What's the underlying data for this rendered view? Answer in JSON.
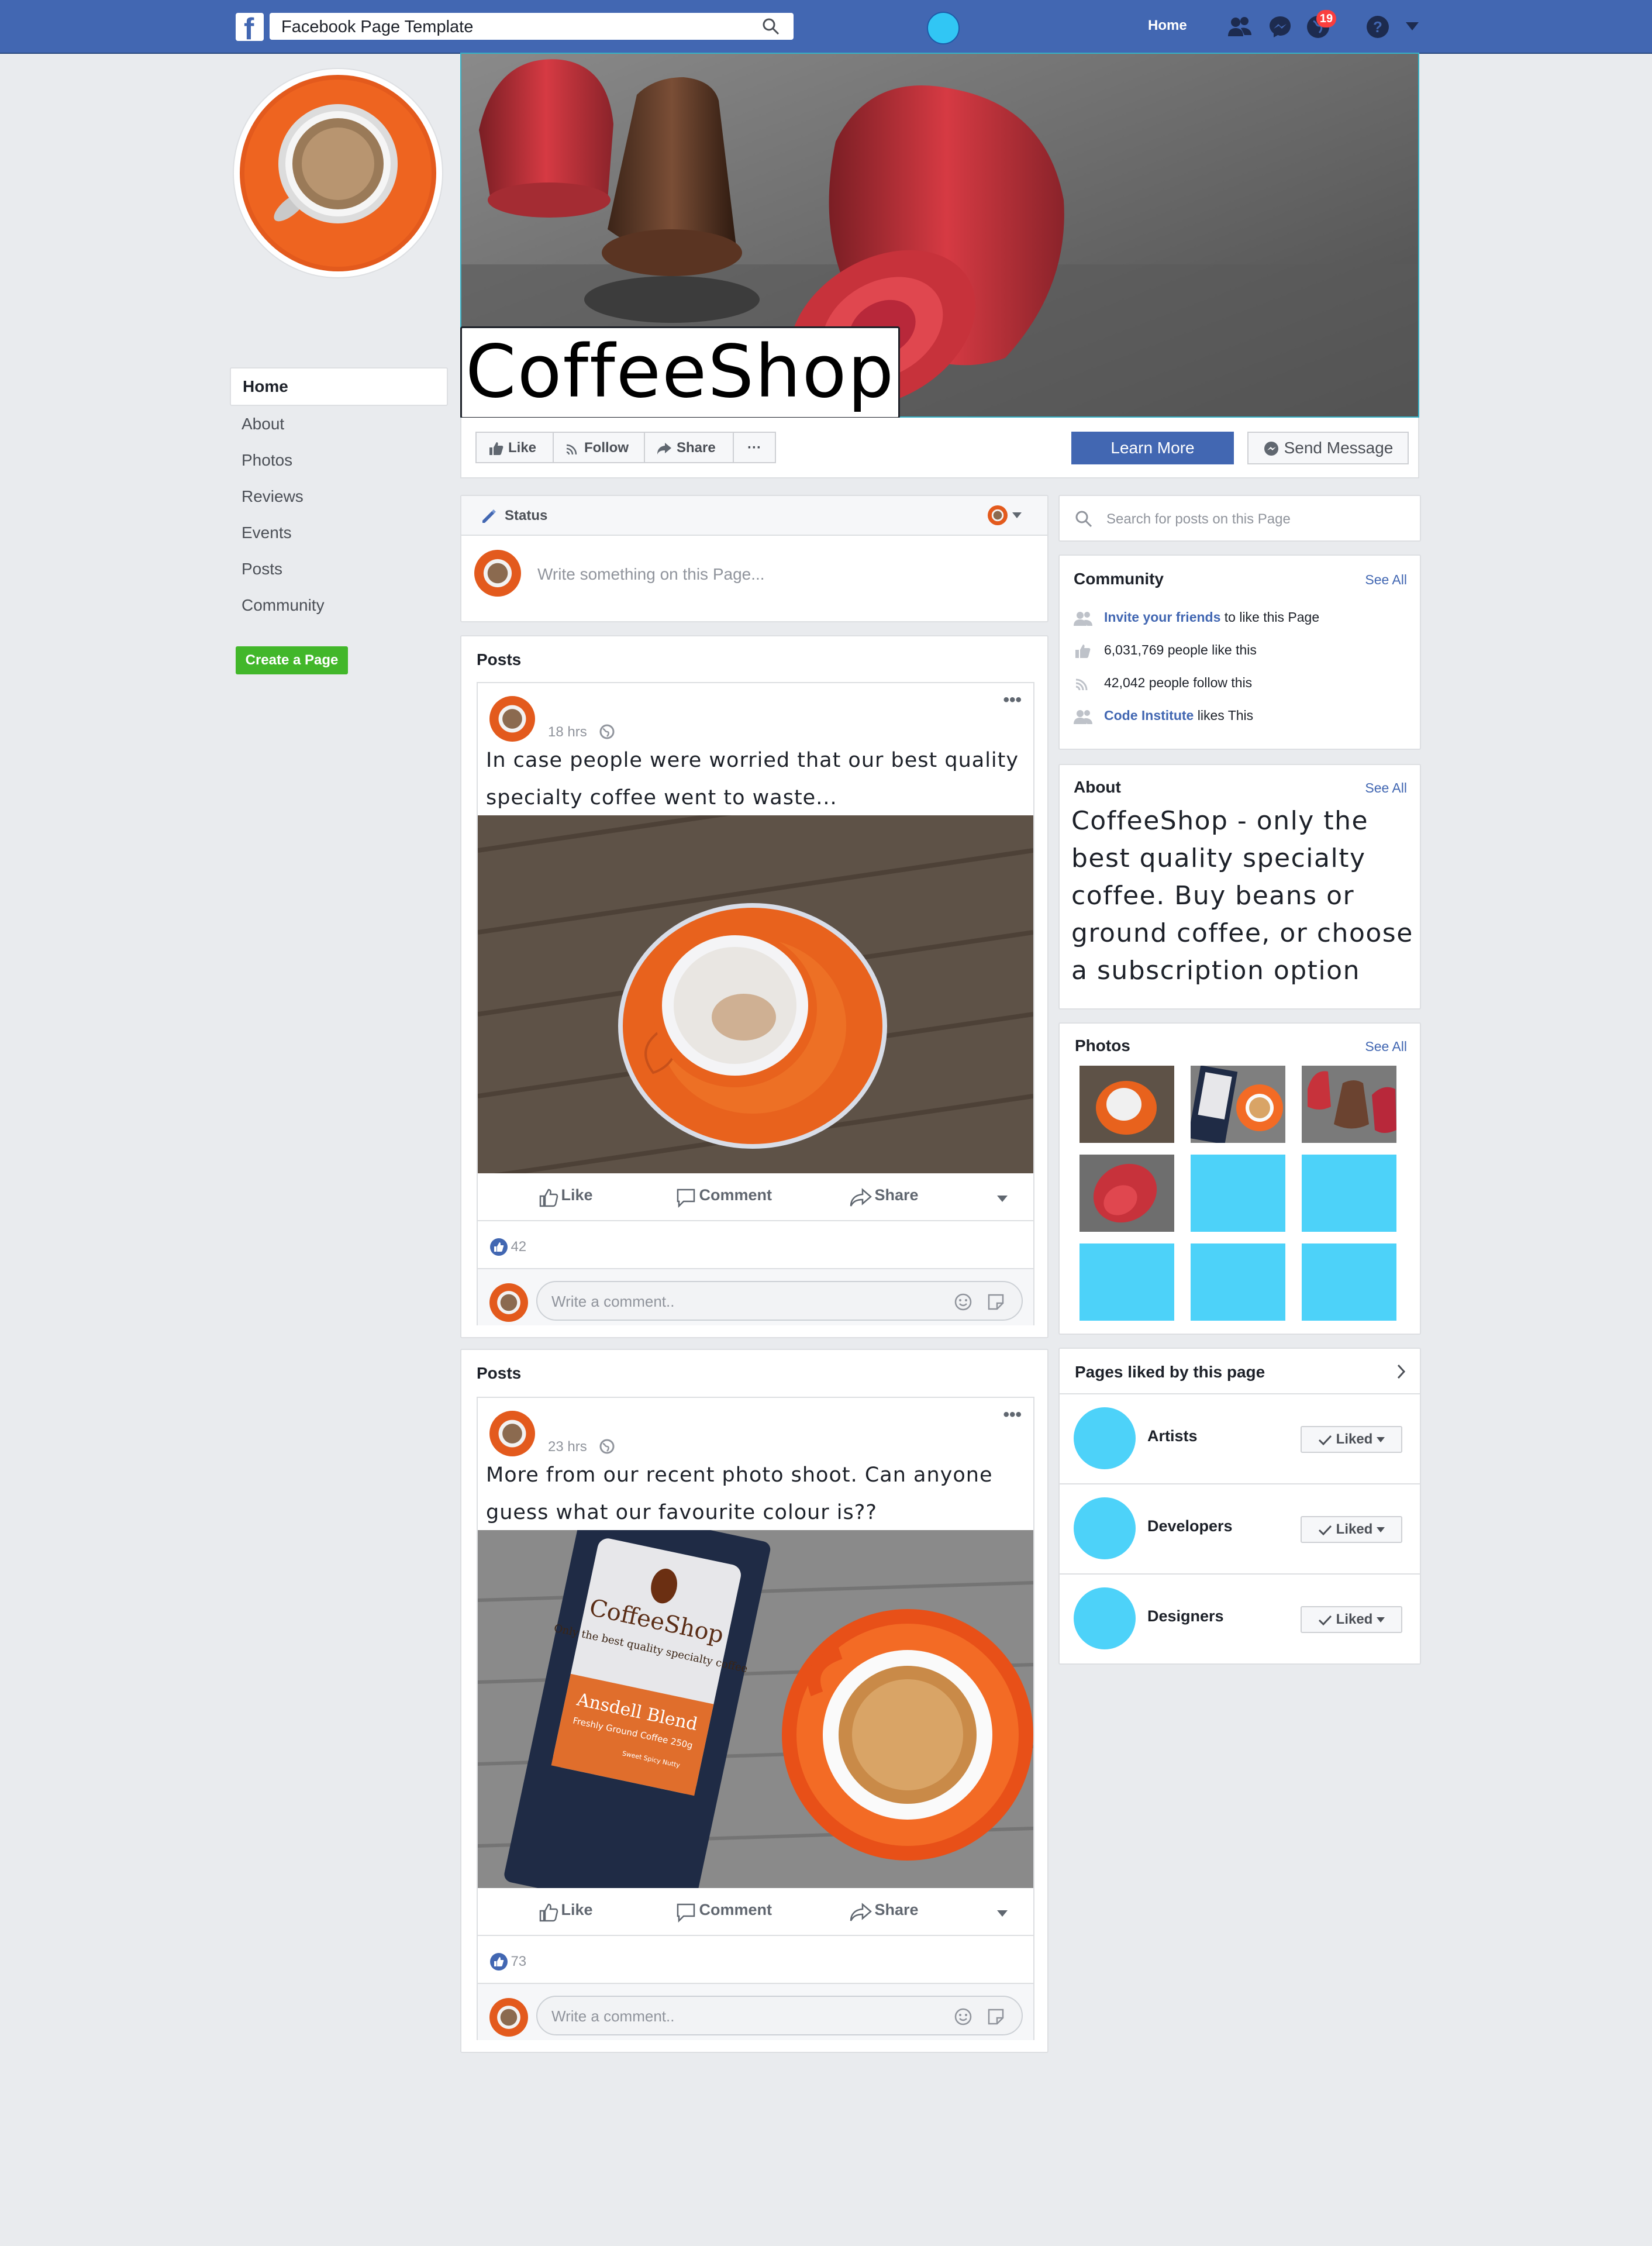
{
  "topbar": {
    "search_value": "Facebook Page Template",
    "home_label": "Home",
    "notification_count": "19"
  },
  "page": {
    "name": "CoffeeShop"
  },
  "leftnav": {
    "items": [
      {
        "label": "Home",
        "active": true
      },
      {
        "label": "About"
      },
      {
        "label": "Photos"
      },
      {
        "label": "Reviews"
      },
      {
        "label": "Events"
      },
      {
        "label": "Posts"
      },
      {
        "label": "Community"
      }
    ],
    "create_page": "Create a Page"
  },
  "actions": {
    "like": "Like",
    "follow": "Follow",
    "share": "Share",
    "more": "···",
    "learn_more": "Learn More",
    "send_message": "Send Message"
  },
  "composer": {
    "status_label": "Status",
    "placeholder": "Write something on this Page..."
  },
  "sidebar_search": {
    "placeholder": "Search for posts on this Page"
  },
  "community": {
    "title": "Community",
    "see_all": "See All",
    "invite_link": "Invite your friends",
    "invite_rest": " to like this Page",
    "likes": "6,031,769 people like this",
    "follows": "42,042 people follow this",
    "ci_link": "Code Institute",
    "ci_rest": " likes This"
  },
  "about": {
    "title": "About",
    "see_all": "See All",
    "text": "CoffeeShop - only the best quality specialty coffee. Buy beans or ground coffee, or choose a subscription option"
  },
  "photos": {
    "title": "Photos",
    "see_all": "See All"
  },
  "pages_liked": {
    "title": "Pages liked by this page",
    "liked_label": "Liked",
    "pages": [
      "Artists",
      "Developers",
      "Designers"
    ]
  },
  "posts": [
    {
      "section_title": "Posts",
      "time": "18 hrs",
      "text": "In case people were worried that our best quality specialty coffee went to waste...",
      "like": "Like",
      "comment": "Comment",
      "share": "Share",
      "reactions": "42",
      "comment_placeholder": "Write a comment.."
    },
    {
      "section_title": "Posts",
      "time": "23 hrs",
      "text": "More from our recent photo shoot. Can anyone guess what our favourite colour is??",
      "like": "Like",
      "comment": "Comment",
      "share": "Share",
      "reactions": "73",
      "comment_placeholder": "Write a comment.."
    }
  ],
  "product": {
    "brand": "CoffeeShop",
    "tagline": "Only the best quality specialty coffee",
    "blend": "Ansdell Blend",
    "blend_sub": "Freshly Ground Coffee 250g",
    "notes": "Sweet Spicy Nutty"
  },
  "colors": {
    "topbar": "#4267b2",
    "accent_cyan": "#4dd2f9",
    "create_green": "#42b72a",
    "badge_red": "#fa3e3e"
  }
}
